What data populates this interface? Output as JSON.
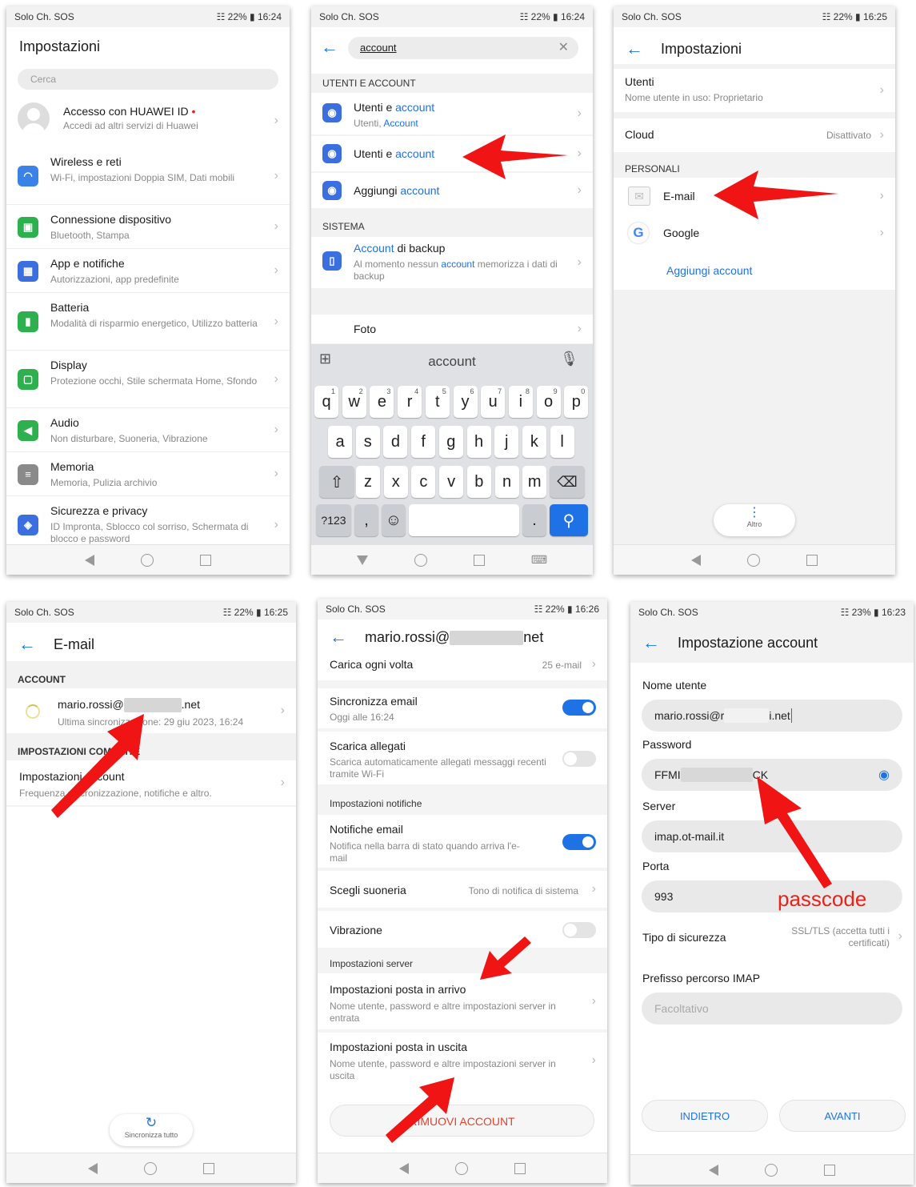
{
  "status": {
    "carrier": "Solo Ch. SOS",
    "p1": "☷ 22% ▮ 16:24",
    "p2": "☷ 22% ▮ 16:24",
    "p3": "☷ 22% ▮ 16:25",
    "p4": "☷ 22% ▮ 16:25",
    "p5": "☷ 22% ▮ 16:26",
    "p6": "☷ 23% ▮ 16:23"
  },
  "p1": {
    "title": "Impostazioni",
    "search_placeholder": "Cerca",
    "huawei_title": "Accesso con HUAWEI ID",
    "huawei_sub": "Accedi ad altri servizi di Huawei",
    "items": [
      {
        "t": "Wireless e reti",
        "s": "Wi-Fi, impostazioni Doppia SIM, Dati mobili",
        "c": "#3b82e8",
        "i": "◠"
      },
      {
        "t": "Connessione dispositivo",
        "s": "Bluetooth, Stampa",
        "c": "#2fb04f",
        "i": "▣"
      },
      {
        "t": "App e notifiche",
        "s": "Autorizzazioni, app predefinite",
        "c": "#3b6fe0",
        "i": "▦"
      },
      {
        "t": "Batteria",
        "s": "Modalità di risparmio energetico, Utilizzo batteria",
        "c": "#2fb04f",
        "i": "▮"
      },
      {
        "t": "Display",
        "s": "Protezione occhi, Stile schermata Home, Sfondo",
        "c": "#2fb04f",
        "i": "▢"
      },
      {
        "t": "Audio",
        "s": "Non disturbare, Suoneria, Vibrazione",
        "c": "#2fb04f",
        "i": "◀"
      },
      {
        "t": "Memoria",
        "s": "Memoria, Pulizia archivio",
        "c": "#8a8a8a",
        "i": "≡"
      },
      {
        "t": "Sicurezza e privacy",
        "s": "ID Impronta, Sblocco col sorriso, Schermata di blocco e password",
        "c": "#3b6fe0",
        "i": "◈"
      }
    ]
  },
  "p2": {
    "search_value": "account",
    "section1": "UTENTI E ACCOUNT",
    "r1_pre": "Utenti e ",
    "r1_hl": "account",
    "r1_sub_pre": "Utenti, ",
    "r1_sub_hl": "Account",
    "r2_pre": "Utenti e ",
    "r2_hl": "account",
    "r3_pre": "Aggiungi ",
    "r3_hl": "account",
    "section2": "SISTEMA",
    "r4_hl": "Account",
    "r4_post": " di backup",
    "r4_sub_pre": "Al momento nessun ",
    "r4_sub_hl": "account",
    "r4_sub_post": " memorizza i dati di backup",
    "foto": "Foto",
    "kb_word": "account",
    "row1": [
      "q",
      "w",
      "e",
      "r",
      "t",
      "y",
      "u",
      "i",
      "o",
      "p"
    ],
    "row1n": [
      "1",
      "2",
      "3",
      "4",
      "5",
      "6",
      "7",
      "8",
      "9",
      "0"
    ],
    "row2": [
      "a",
      "s",
      "d",
      "f",
      "g",
      "h",
      "j",
      "k",
      "l"
    ],
    "row3": [
      "z",
      "x",
      "c",
      "v",
      "b",
      "n",
      "m"
    ],
    "k123": "?123",
    "comma": ",",
    "period": "."
  },
  "p3": {
    "title": "Impostazioni",
    "utenti": "Utenti",
    "utenti_sub": "Nome utente in uso: Proprietario",
    "cloud": "Cloud",
    "cloud_val": "Disattivato",
    "section": "PERSONALI",
    "email": "E-mail",
    "google": "Google",
    "add": "Aggiungi account",
    "altro": "Altro"
  },
  "p4": {
    "title": "E-mail",
    "section1": "ACCOUNT",
    "acc_pre": "mario.rossi@",
    "acc_post": ".net",
    "acc_sub": "Ultima sincronizzazione: 29 giu 2023, 16:24",
    "section2": "IMPOSTAZIONI COMUNITE",
    "imp_t": "Impostazioni account",
    "imp_s": "Frequenza sincronizzazione, notifiche e altro.",
    "sync": "Sincronizza tutto"
  },
  "p5": {
    "title_pre": "mario.rossi@",
    "title_post": "net",
    "carica": "Carica ogni volta",
    "carica_val": "25 e-mail",
    "sinc_t": "Sincronizza email",
    "sinc_s": "Oggi alle 16:24",
    "scar_t": "Scarica allegati",
    "scar_s": "Scarica automaticamente allegati messaggi recenti tramite Wi-Fi",
    "sect_notif": "Impostazioni notifiche",
    "notif_t": "Notifiche email",
    "notif_s": "Notifica nella barra di stato quando arriva l'e-mail",
    "suon_t": "Scegli suoneria",
    "suon_val": "Tono di notifica di sistema",
    "vib_t": "Vibrazione",
    "sect_server": "Impostazioni server",
    "arr_t": "Impostazioni posta in arrivo",
    "arr_s": "Nome utente, password e altre impostazioni server in entrata",
    "usc_t": "Impostazioni posta in uscita",
    "usc_s": "Nome utente, password e altre impostazioni server in uscita",
    "rimuovi": "RIMUOVI ACCOUNT"
  },
  "p6": {
    "title": "Impostazione account",
    "lbl_user": "Nome utente",
    "user_pre": "mario.rossi@r",
    "user_post": "i.net",
    "lbl_pw": "Password",
    "pw_pre": "FFMI",
    "pw_post": "CK",
    "lbl_server": "Server",
    "server": "imap.ot-mail.it",
    "lbl_porta": "Porta",
    "porta": "993",
    "passcode": "passcode",
    "lbl_tipo": "Tipo di sicurezza",
    "tipo_val": "SSL/TLS (accetta tutti i certificati)",
    "lbl_prefisso": "Prefisso percorso IMAP",
    "prefisso_ph": "Facoltativo",
    "indietro": "INDIETRO",
    "avanti": "AVANTI"
  }
}
